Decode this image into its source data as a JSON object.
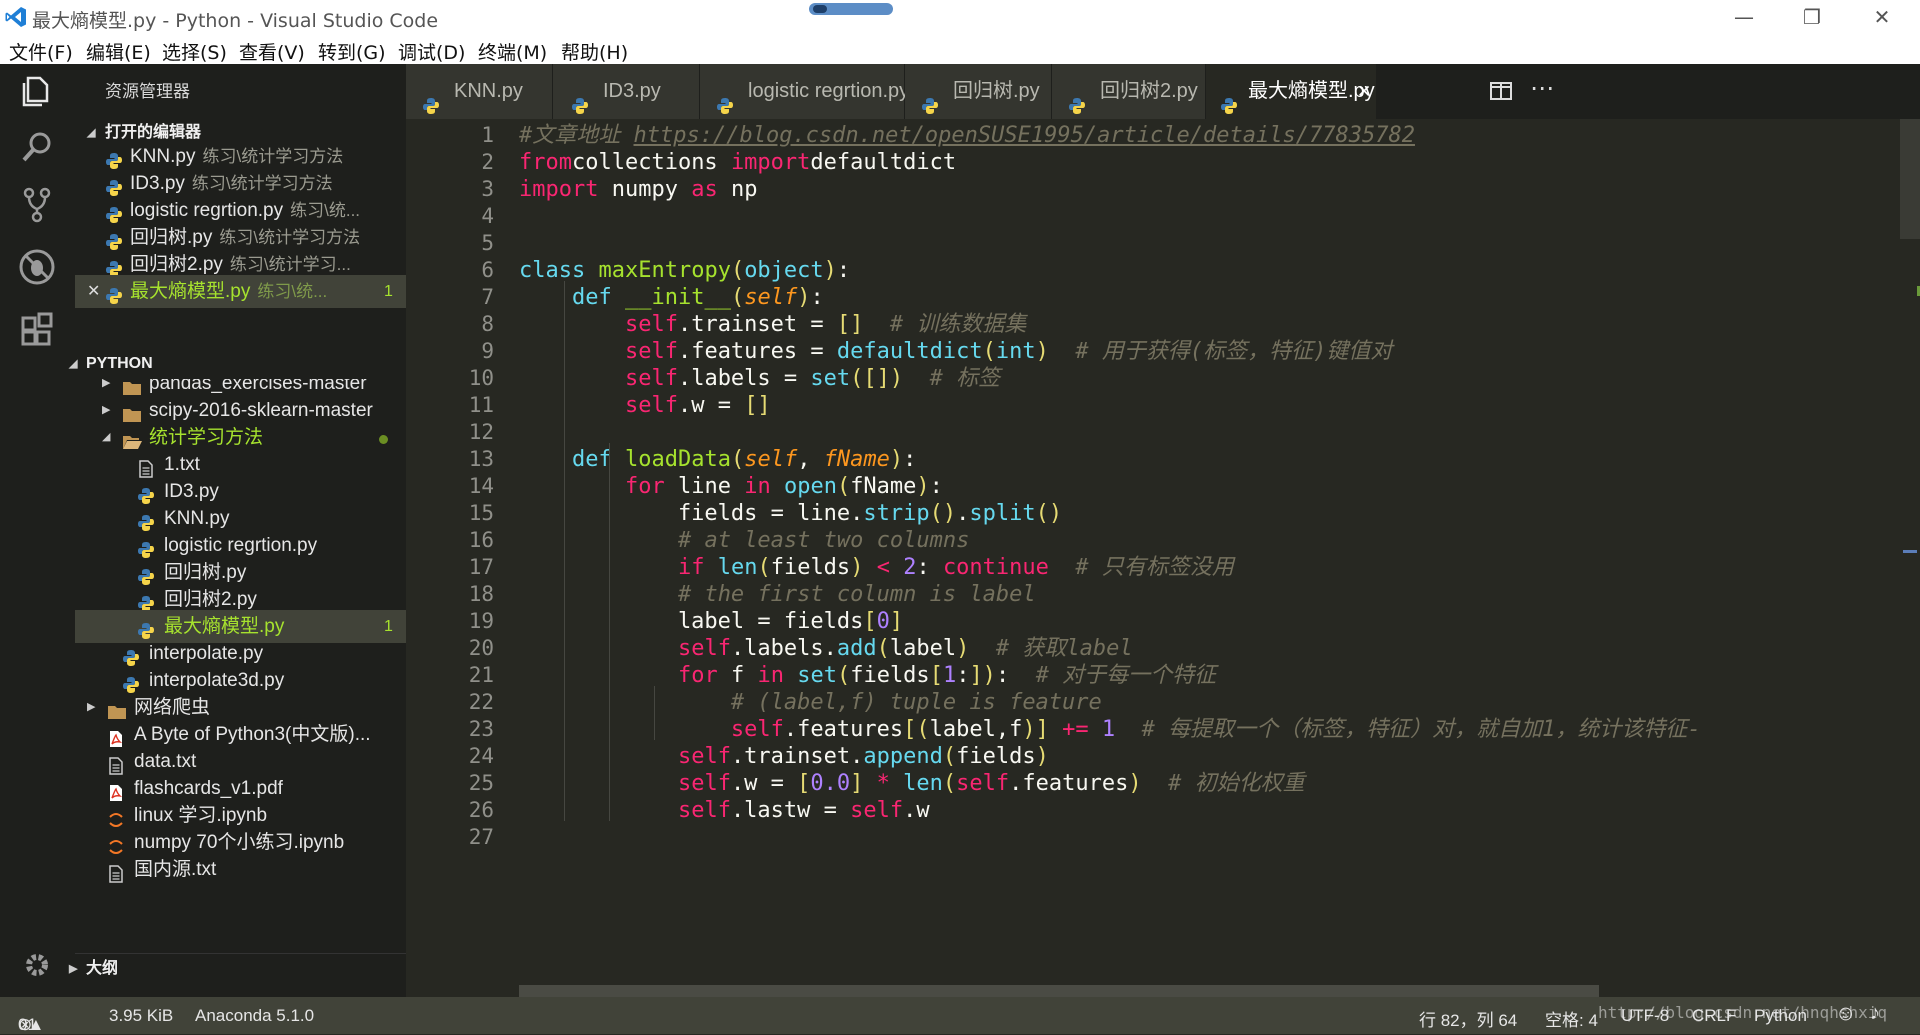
{
  "window": {
    "title": "最大熵模型.py - Python - Visual Studio Code"
  },
  "menu": [
    "文件(F)",
    "编辑(E)",
    "选择(S)",
    "查看(V)",
    "转到(G)",
    "调试(D)",
    "终端(M)",
    "帮助(H)"
  ],
  "sidebar": {
    "header": "资源管理器",
    "open_editors_title": "打开的编辑器",
    "open_editors": [
      {
        "name": "KNN.py",
        "desc": "练习\\统计学习方法",
        "active": false
      },
      {
        "name": "ID3.py",
        "desc": "练习\\统计学习方法",
        "active": false
      },
      {
        "name": "logistic regrtion.py",
        "desc": "练习\\统...",
        "active": false
      },
      {
        "name": "回归树.py",
        "desc": "练习\\统计学习方法",
        "active": false
      },
      {
        "name": "回归树2.py",
        "desc": "练习\\统计学习...",
        "active": false
      },
      {
        "name": "最大熵模型.py",
        "desc": "练习\\统...",
        "badge": "1",
        "active": true
      }
    ],
    "python_title": "PYTHON",
    "tree": [
      {
        "name": "pandas_exercises-master",
        "type": "folder",
        "indent": 1
      },
      {
        "name": "scipy-2016-sklearn-master",
        "type": "folder",
        "indent": 1
      },
      {
        "name": "统计学习方法",
        "type": "folder-open",
        "indent": 1
      },
      {
        "name": "1.txt",
        "type": "txt",
        "indent": 2
      },
      {
        "name": "ID3.py",
        "type": "py",
        "indent": 2
      },
      {
        "name": "KNN.py",
        "type": "py",
        "indent": 2
      },
      {
        "name": "logistic regrtion.py",
        "type": "py",
        "indent": 2
      },
      {
        "name": "回归树.py",
        "type": "py",
        "indent": 2
      },
      {
        "name": "回归树2.py",
        "type": "py",
        "indent": 2
      },
      {
        "name": "最大熵模型.py",
        "type": "py",
        "indent": 2,
        "badge": "1"
      },
      {
        "name": "interpolate.py",
        "type": "py",
        "indent": 1
      },
      {
        "name": "interpolate3d.py",
        "type": "py",
        "indent": 1
      },
      {
        "name": "网络爬虫",
        "type": "folder",
        "indent": 0
      },
      {
        "name": "A Byte of Python3(中文版)...",
        "type": "pdf",
        "indent": 0
      },
      {
        "name": "data.txt",
        "type": "txt",
        "indent": 0
      },
      {
        "name": "flashcards_v1.pdf",
        "type": "pdf",
        "indent": 0
      },
      {
        "name": "linux 学习.ipynb",
        "type": "nb",
        "indent": 0
      },
      {
        "name": "numpy 70个小练习.ipynb",
        "type": "nb",
        "indent": 0
      },
      {
        "name": "国内源.txt",
        "type": "txt",
        "indent": 0
      }
    ],
    "outline_title": "大纲"
  },
  "tabs": [
    {
      "label": "KNN.py"
    },
    {
      "label": "ID3.py"
    },
    {
      "label": "logistic regrtion.py"
    },
    {
      "label": "回归树.py"
    },
    {
      "label": "回归树2.py"
    },
    {
      "label": "最大熵模型.py",
      "active": true,
      "close": "✕"
    }
  ],
  "code": [
    [
      [
        "cm",
        "#文章地址 "
      ],
      [
        "cm url",
        "https://blog.csdn.net/openSUSE1995/article/details/77835782"
      ]
    ],
    [
      [
        "kw",
        "from"
      ],
      [
        "",
        "collections "
      ],
      [
        "kw",
        "import"
      ],
      [
        "",
        "defaultdict"
      ]
    ],
    [
      [
        "kw",
        "import"
      ],
      [
        "",
        " numpy "
      ],
      [
        "kw",
        "as"
      ],
      [
        "",
        " np"
      ]
    ],
    [],
    [],
    [
      [
        "bi",
        "class"
      ],
      [
        "",
        " "
      ],
      [
        "fn",
        "maxEntropy"
      ],
      [
        "br",
        "("
      ],
      [
        "bi",
        "object"
      ],
      [
        "br",
        ")"
      ],
      [
        "",
        ":"
      ]
    ],
    [
      [
        "",
        "    "
      ],
      [
        "bi",
        "def"
      ],
      [
        "",
        " "
      ],
      [
        "fn",
        "__init__"
      ],
      [
        "br",
        "("
      ],
      [
        "pa",
        "self"
      ],
      [
        "br",
        ")"
      ],
      [
        "",
        ":"
      ]
    ],
    [
      [
        "",
        "        "
      ],
      [
        "kw",
        "self"
      ],
      [
        "",
        ".trainset = "
      ],
      [
        "br",
        "[]"
      ],
      [
        "",
        "  "
      ],
      [
        "cm",
        "# 训练数据集"
      ]
    ],
    [
      [
        "",
        "        "
      ],
      [
        "kw",
        "self"
      ],
      [
        "",
        ".features = "
      ],
      [
        "bi",
        "defaultdict"
      ],
      [
        "br",
        "("
      ],
      [
        "bi",
        "int"
      ],
      [
        "br",
        ")"
      ],
      [
        "",
        "  "
      ],
      [
        "cm",
        "# 用于获得(标签，特征)键值对"
      ]
    ],
    [
      [
        "",
        "        "
      ],
      [
        "kw",
        "self"
      ],
      [
        "",
        ".labels = "
      ],
      [
        "bi",
        "set"
      ],
      [
        "br",
        "([])"
      ],
      [
        "",
        "  "
      ],
      [
        "cm",
        "# 标签"
      ]
    ],
    [
      [
        "",
        "        "
      ],
      [
        "kw",
        "self"
      ],
      [
        "",
        ".w = "
      ],
      [
        "br",
        "[]"
      ]
    ],
    [],
    [
      [
        "",
        "    "
      ],
      [
        "bi",
        "def"
      ],
      [
        "",
        " "
      ],
      [
        "fn",
        "loadData"
      ],
      [
        "br",
        "("
      ],
      [
        "pa",
        "self"
      ],
      [
        "",
        ", "
      ],
      [
        "pa",
        "fName"
      ],
      [
        "br",
        ")"
      ],
      [
        "",
        ":"
      ]
    ],
    [
      [
        "",
        "        "
      ],
      [
        "kw",
        "for"
      ],
      [
        "",
        " line "
      ],
      [
        "kw",
        "in"
      ],
      [
        "",
        " "
      ],
      [
        "bi",
        "open"
      ],
      [
        "br",
        "("
      ],
      [
        "",
        "fName"
      ],
      [
        "br",
        ")"
      ],
      [
        "",
        ":"
      ]
    ],
    [
      [
        "",
        "            fields = line."
      ],
      [
        "bi",
        "strip"
      ],
      [
        "br",
        "()"
      ],
      [
        "",
        "."
      ],
      [
        "bi",
        "split"
      ],
      [
        "br",
        "()"
      ]
    ],
    [
      [
        "",
        "            "
      ],
      [
        "cm",
        "# at least two columns"
      ]
    ],
    [
      [
        "",
        "            "
      ],
      [
        "kw",
        "if"
      ],
      [
        "",
        " "
      ],
      [
        "bi",
        "len"
      ],
      [
        "br",
        "("
      ],
      [
        "",
        "fields"
      ],
      [
        "br",
        ")"
      ],
      [
        "",
        " "
      ],
      [
        "kw",
        "<"
      ],
      [
        "",
        " "
      ],
      [
        "num",
        "2"
      ],
      [
        "",
        ": "
      ],
      [
        "kw",
        "continue"
      ],
      [
        "",
        "  "
      ],
      [
        "cm",
        "# 只有标签没用"
      ]
    ],
    [
      [
        "",
        "            "
      ],
      [
        "cm",
        "# the first column is label"
      ]
    ],
    [
      [
        "",
        "            label = fields"
      ],
      [
        "br",
        "["
      ],
      [
        "num",
        "0"
      ],
      [
        "br",
        "]"
      ]
    ],
    [
      [
        "",
        "            "
      ],
      [
        "kw",
        "self"
      ],
      [
        "",
        ".labels."
      ],
      [
        "bi",
        "add"
      ],
      [
        "br",
        "("
      ],
      [
        "",
        "label"
      ],
      [
        "br",
        ")"
      ],
      [
        "",
        "  "
      ],
      [
        "cm",
        "# 获取label"
      ]
    ],
    [
      [
        "",
        "            "
      ],
      [
        "kw",
        "for"
      ],
      [
        "",
        " f "
      ],
      [
        "kw",
        "in"
      ],
      [
        "",
        " "
      ],
      [
        "bi",
        "set"
      ],
      [
        "br",
        "("
      ],
      [
        "",
        "fields"
      ],
      [
        "br",
        "["
      ],
      [
        "num",
        "1"
      ],
      [
        "",
        ":"
      ],
      [
        "br",
        "])"
      ],
      [
        "",
        ":  "
      ],
      [
        "cm",
        "# 对于每一个特征"
      ]
    ],
    [
      [
        "",
        "                "
      ],
      [
        "cm",
        "# (label,f) tuple is feature"
      ]
    ],
    [
      [
        "",
        "                "
      ],
      [
        "kw",
        "self"
      ],
      [
        "",
        ".features"
      ],
      [
        "br",
        "[("
      ],
      [
        "",
        "label,f"
      ],
      [
        "br",
        ")]"
      ],
      [
        "",
        " "
      ],
      [
        "kw",
        "+="
      ],
      [
        "",
        " "
      ],
      [
        "num",
        "1"
      ],
      [
        "",
        "  "
      ],
      [
        "cm",
        "# 每提取一个（标签，特征）对，就自加1，统计该特征-"
      ]
    ],
    [
      [
        "",
        "            "
      ],
      [
        "kw",
        "self"
      ],
      [
        "",
        ".trainset."
      ],
      [
        "bi",
        "append"
      ],
      [
        "br",
        "("
      ],
      [
        "",
        "fields"
      ],
      [
        "br",
        ")"
      ]
    ],
    [
      [
        "",
        "            "
      ],
      [
        "kw",
        "self"
      ],
      [
        "",
        ".w = "
      ],
      [
        "br",
        "["
      ],
      [
        "num",
        "0.0"
      ],
      [
        "br",
        "]"
      ],
      [
        "",
        " "
      ],
      [
        "kw",
        "*"
      ],
      [
        "",
        " "
      ],
      [
        "bi",
        "len"
      ],
      [
        "br",
        "("
      ],
      [
        "kw",
        "self"
      ],
      [
        "",
        ".features"
      ],
      [
        "br",
        ")"
      ],
      [
        "",
        "  "
      ],
      [
        "cm",
        "# 初始化权重"
      ]
    ],
    [
      [
        "",
        "            "
      ],
      [
        "kw",
        "self"
      ],
      [
        "",
        ".lastw = "
      ],
      [
        "kw",
        "self"
      ],
      [
        "",
        ".w"
      ]
    ],
    []
  ],
  "status": {
    "errors": "0",
    "warnings": "1",
    "size": "3.95 KiB",
    "interpreter": "Anaconda 5.1.0",
    "position": "行 82，列 64",
    "spaces": "空格: 4",
    "encoding": "UTF-8",
    "eol": "CRLF",
    "language": "Python",
    "watermark": "http://blog.csdn.net/hnqhshxiq"
  },
  "colors": {
    "bg": "#272822",
    "sidebar": "#1e1f1c",
    "status": "#414339",
    "keyword": "#f92672",
    "function": "#a6e22e",
    "builtin": "#66d9ef",
    "number": "#ae81ff",
    "comment": "#75715e",
    "param": "#fd971f",
    "bracket": "#e6db74"
  }
}
